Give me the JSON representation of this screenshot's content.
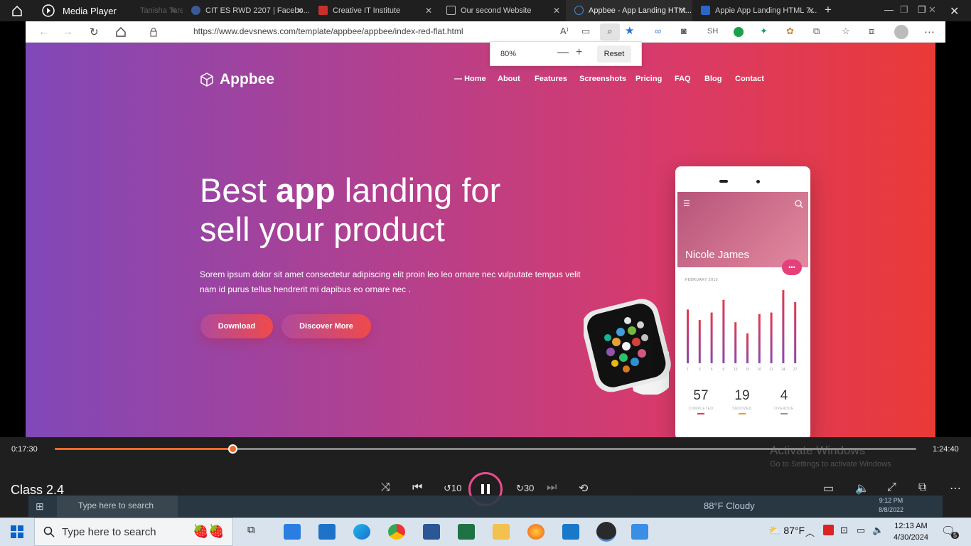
{
  "media_player": {
    "title": "Media Player",
    "video_title": "Class 2.4",
    "time_current": "0:17:30",
    "time_total": "1:24:40",
    "progress_fraction": 0.207,
    "watermark_line1": "Activate Windows",
    "watermark_line2": "Go to Settings to activate Windows"
  },
  "browser": {
    "tabs": [
      {
        "label": "Tanisha Taresa messaged B...",
        "active": false
      },
      {
        "label": "CIT ES RWD 2207 | Facebo...",
        "active": false
      },
      {
        "label": "Creative IT Institute",
        "active": false
      },
      {
        "label": "Our second Website",
        "active": false
      },
      {
        "label": "Appbee - App Landing HTM...",
        "active": true
      },
      {
        "label": "Appie App Landing HTML 7...",
        "active": false
      }
    ],
    "url": "https://www.devsnews.com/template/appbee/appbee/index-red-flat.html",
    "profile_initials": "SH",
    "zoom": {
      "value": "80%",
      "reset_label": "Reset"
    }
  },
  "site": {
    "logo": "Appbee",
    "nav": [
      "Home",
      "About",
      "Features",
      "Screenshots",
      "Pricing",
      "FAQ",
      "Blog",
      "Contact"
    ],
    "hero_title_pre": "Best ",
    "hero_title_bold": "app",
    "hero_title_post": " landing for",
    "hero_title_line2": "sell your product",
    "hero_desc": "Sorem ipsum dolor sit amet consectetur adipiscing elit proin leo leo ornare nec vulputate tempus velit nam id purus tellus hendrerit mi dapibus eo ornare nec .",
    "btn_download": "Download",
    "btn_discover": "Discover More",
    "phone": {
      "profile_name": "Nicole James",
      "month": "FEBRUARY 2015",
      "bars": [
        0.72,
        0.58,
        0.68,
        0.85,
        0.55,
        0.4,
        0.66,
        0.68,
        0.98,
        0.82
      ],
      "bar_labels": [
        "1",
        "3",
        "6",
        "9",
        "13",
        "15",
        "16",
        "21",
        "24",
        "27"
      ],
      "stats": [
        {
          "value": "57",
          "label": "COMPLETED",
          "color": "#e4394a"
        },
        {
          "value": "19",
          "label": "SNOOZED",
          "color": "#f29a30"
        },
        {
          "value": "4",
          "label": "OVERDUE",
          "color": "#8a94a8"
        }
      ]
    }
  },
  "inner_taskbar": {
    "search_placeholder": "Type here to search",
    "weather": "88°F Cloudy",
    "time": "9:12 PM",
    "date": "8/8/2022"
  },
  "taskbar": {
    "search_placeholder": "Type here to search",
    "weather": "87°F",
    "time": "12:13 AM",
    "date": "4/30/2024",
    "notification_count": "5"
  }
}
